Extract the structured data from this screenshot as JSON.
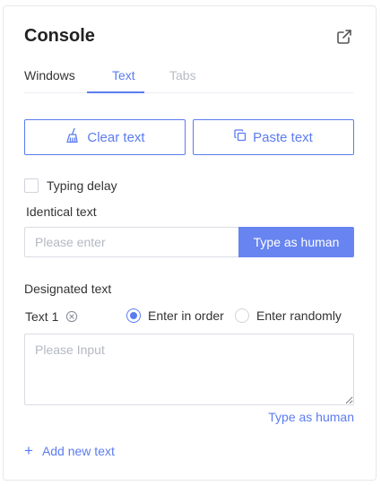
{
  "header": {
    "title": "Console",
    "external_icon": "external-link-icon"
  },
  "tabs": [
    {
      "label": "Windows",
      "state": "normal"
    },
    {
      "label": "Text",
      "state": "active"
    },
    {
      "label": "Tabs",
      "state": "disabled"
    }
  ],
  "actions": {
    "clear_label": "Clear text",
    "clear_icon": "broom-icon",
    "paste_label": "Paste text",
    "paste_icon": "copy-icon"
  },
  "typing_delay": {
    "label": "Typing delay",
    "checked": false
  },
  "identical": {
    "label": "Identical text",
    "placeholder": "Please enter",
    "button_label": "Type as human"
  },
  "designated": {
    "label": "Designated text",
    "items": [
      {
        "label": "Text 1",
        "remove_icon": "remove-circle-icon",
        "options": [
          {
            "label": "Enter in order",
            "selected": true
          },
          {
            "label": "Enter randomly",
            "selected": false
          }
        ],
        "placeholder": "Please Input",
        "action_label": "Type as human"
      }
    ],
    "add_label": "Add new text"
  },
  "colors": {
    "accent": "#5b7cf0",
    "primary_button": "#6784f0",
    "muted": "#b7bcc6"
  }
}
